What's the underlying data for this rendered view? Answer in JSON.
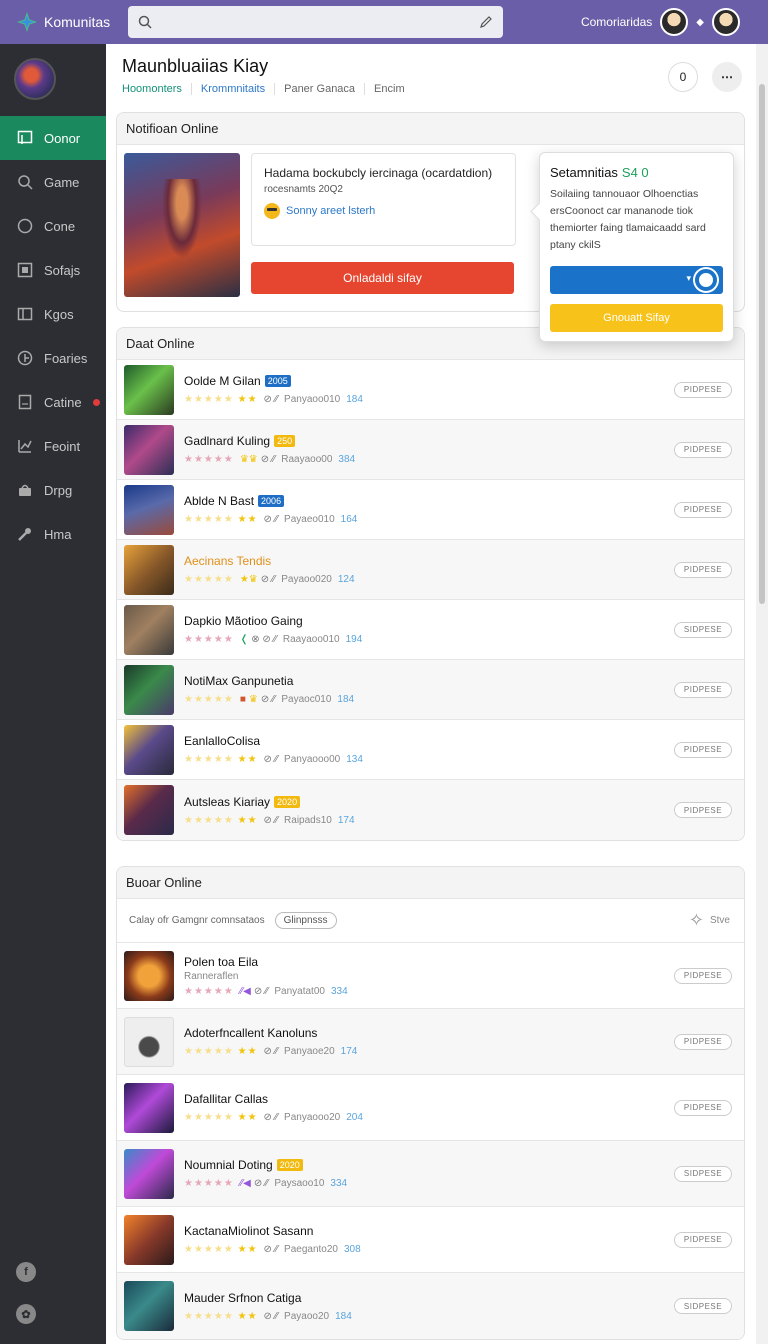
{
  "app": {
    "brand": "Komunitas",
    "search_placeholder": "",
    "top_link": "Comoriaridas",
    "top_diamond": "◆"
  },
  "sidebar": {
    "items": [
      {
        "label": "Oonor",
        "icon": "square-icon"
      },
      {
        "label": "Game",
        "icon": "search-icon"
      },
      {
        "label": "Cone",
        "icon": "circle-icon"
      },
      {
        "label": "Sofajs",
        "icon": "grid-icon"
      },
      {
        "label": "Kgos",
        "icon": "box-icon"
      },
      {
        "label": "Foaries",
        "icon": "shield-icon"
      },
      {
        "label": "Catine",
        "icon": "document-icon"
      },
      {
        "label": "Feoint",
        "icon": "chart-icon"
      },
      {
        "label": "Drpg",
        "icon": "bag-icon"
      },
      {
        "label": "Hma",
        "icon": "wrench-icon"
      }
    ],
    "bottom_icons": [
      "f",
      "✿"
    ]
  },
  "page": {
    "title": "Maunbluaiias Kiay",
    "tabs": [
      "Hoomonters",
      "Krommnitaits",
      "Paner Ganaca",
      "Encim"
    ],
    "btn_clip": "0",
    "btn_more": "⋯"
  },
  "notification": {
    "header": "Notifioan Online",
    "msg_title": "Hadama bockubcly iercinaga (ocardatdion)",
    "msg_sub": "rocesnamts 20Q2",
    "msg_link": "Sonny areet lsterh",
    "button": "Onladaldi sifay"
  },
  "popup": {
    "title": "Setamnitias",
    "title_accent": "S4 0",
    "text": "Soilaiing tannouaor Olhoenctias ersCoonoct car mananode tiok themiorter faing tlamaicaadd sard ptany ckilS",
    "yellow_button": "Gnouatt Sifay"
  },
  "dart": {
    "header": "Daat Online",
    "rows": [
      {
        "title": "Oolde M Gilan",
        "tag": "2005",
        "tag_color": "blue",
        "stars_full": 2,
        "meta": "Panyaoo010",
        "num": "184",
        "pill": "PIDPESE"
      },
      {
        "title": "Gadlnard Kuling",
        "tag": "250",
        "tag_color": "yellow",
        "stars_full": 0,
        "meta": "Raayaoo00",
        "num": "384",
        "pill": "PIDPESE"
      },
      {
        "title": "Ablde N Bast",
        "tag": "2006",
        "tag_color": "blue",
        "stars_full": 2,
        "meta": "Payaeo010",
        "num": "164",
        "pill": "PIDPESE"
      },
      {
        "title": "Aecinans Tendis",
        "tag": "",
        "tag_color": "",
        "orange": true,
        "stars_full": 0,
        "meta": "Payaoo020",
        "num": "124",
        "pill": "PIDPESE"
      },
      {
        "title": "Dapkio Mãotioo Gaing",
        "tag": "",
        "tag_color": "",
        "stars_full": 0,
        "meta": "Raayaoo010",
        "num": "194",
        "pill": "SIDPESE"
      },
      {
        "title": "NotiMax Ganpunetia",
        "tag": "",
        "tag_color": "",
        "stars_full": 0,
        "meta": "Payaoc010",
        "num": "184",
        "pill": "PIDPESE"
      },
      {
        "title": "EanlalloColisa",
        "tag": "",
        "tag_color": "",
        "stars_full": 2,
        "meta": "Panyaooo00",
        "num": "134",
        "pill": "PIDPESE"
      },
      {
        "title": "Autsleas Kiariay",
        "tag": "2020",
        "tag_color": "yellow",
        "stars_full": 2,
        "meta": "Raipads10",
        "num": "174",
        "pill": "PIDPESE"
      }
    ]
  },
  "buoa": {
    "header": "Buoar Online",
    "filter_text": "Calay ofr Gamgnr comnsataos",
    "chip": "Glinpnsss",
    "share": "Stve",
    "rows": [
      {
        "title": "Polen toa Eila",
        "sub": "Ranneraflen",
        "stars_full": 0,
        "meta": "Panyatat00",
        "num": "334",
        "pill": "PIDPESE"
      },
      {
        "title": "Adoterfncallent Kanoluns",
        "sub": "",
        "stars_full": 2,
        "meta": "Panyaoe20",
        "num": "174",
        "pill": "PIDPESE"
      },
      {
        "title": "Dafallitar Callas",
        "sub": "",
        "stars_full": 2,
        "meta": "Panyaooo20",
        "num": "204",
        "pill": "PIDPESE"
      },
      {
        "title": "Noumnial Doting",
        "tag": "2020",
        "sub": "",
        "stars_full": 0,
        "meta": "Paysaoo10",
        "num": "334",
        "pill": "SIDPESE"
      },
      {
        "title": "KactanaMiolinot Sasann",
        "sub": "",
        "stars_full": 2,
        "meta": "Paeganto20",
        "num": "308",
        "pill": "PIDPESE"
      },
      {
        "title": "Mauder Srfnon Catiga",
        "sub": "",
        "stars_full": 2,
        "meta": "Payaoo20",
        "num": "184",
        "pill": "SIDPESE"
      }
    ]
  },
  "colors": {
    "topbar": "#6b5ea8",
    "sidebar": "#2c2e33",
    "active": "#1a8a5e",
    "red_button": "#e6462f",
    "blue_button": "#1a73c9",
    "yellow_button": "#f7c31b"
  }
}
